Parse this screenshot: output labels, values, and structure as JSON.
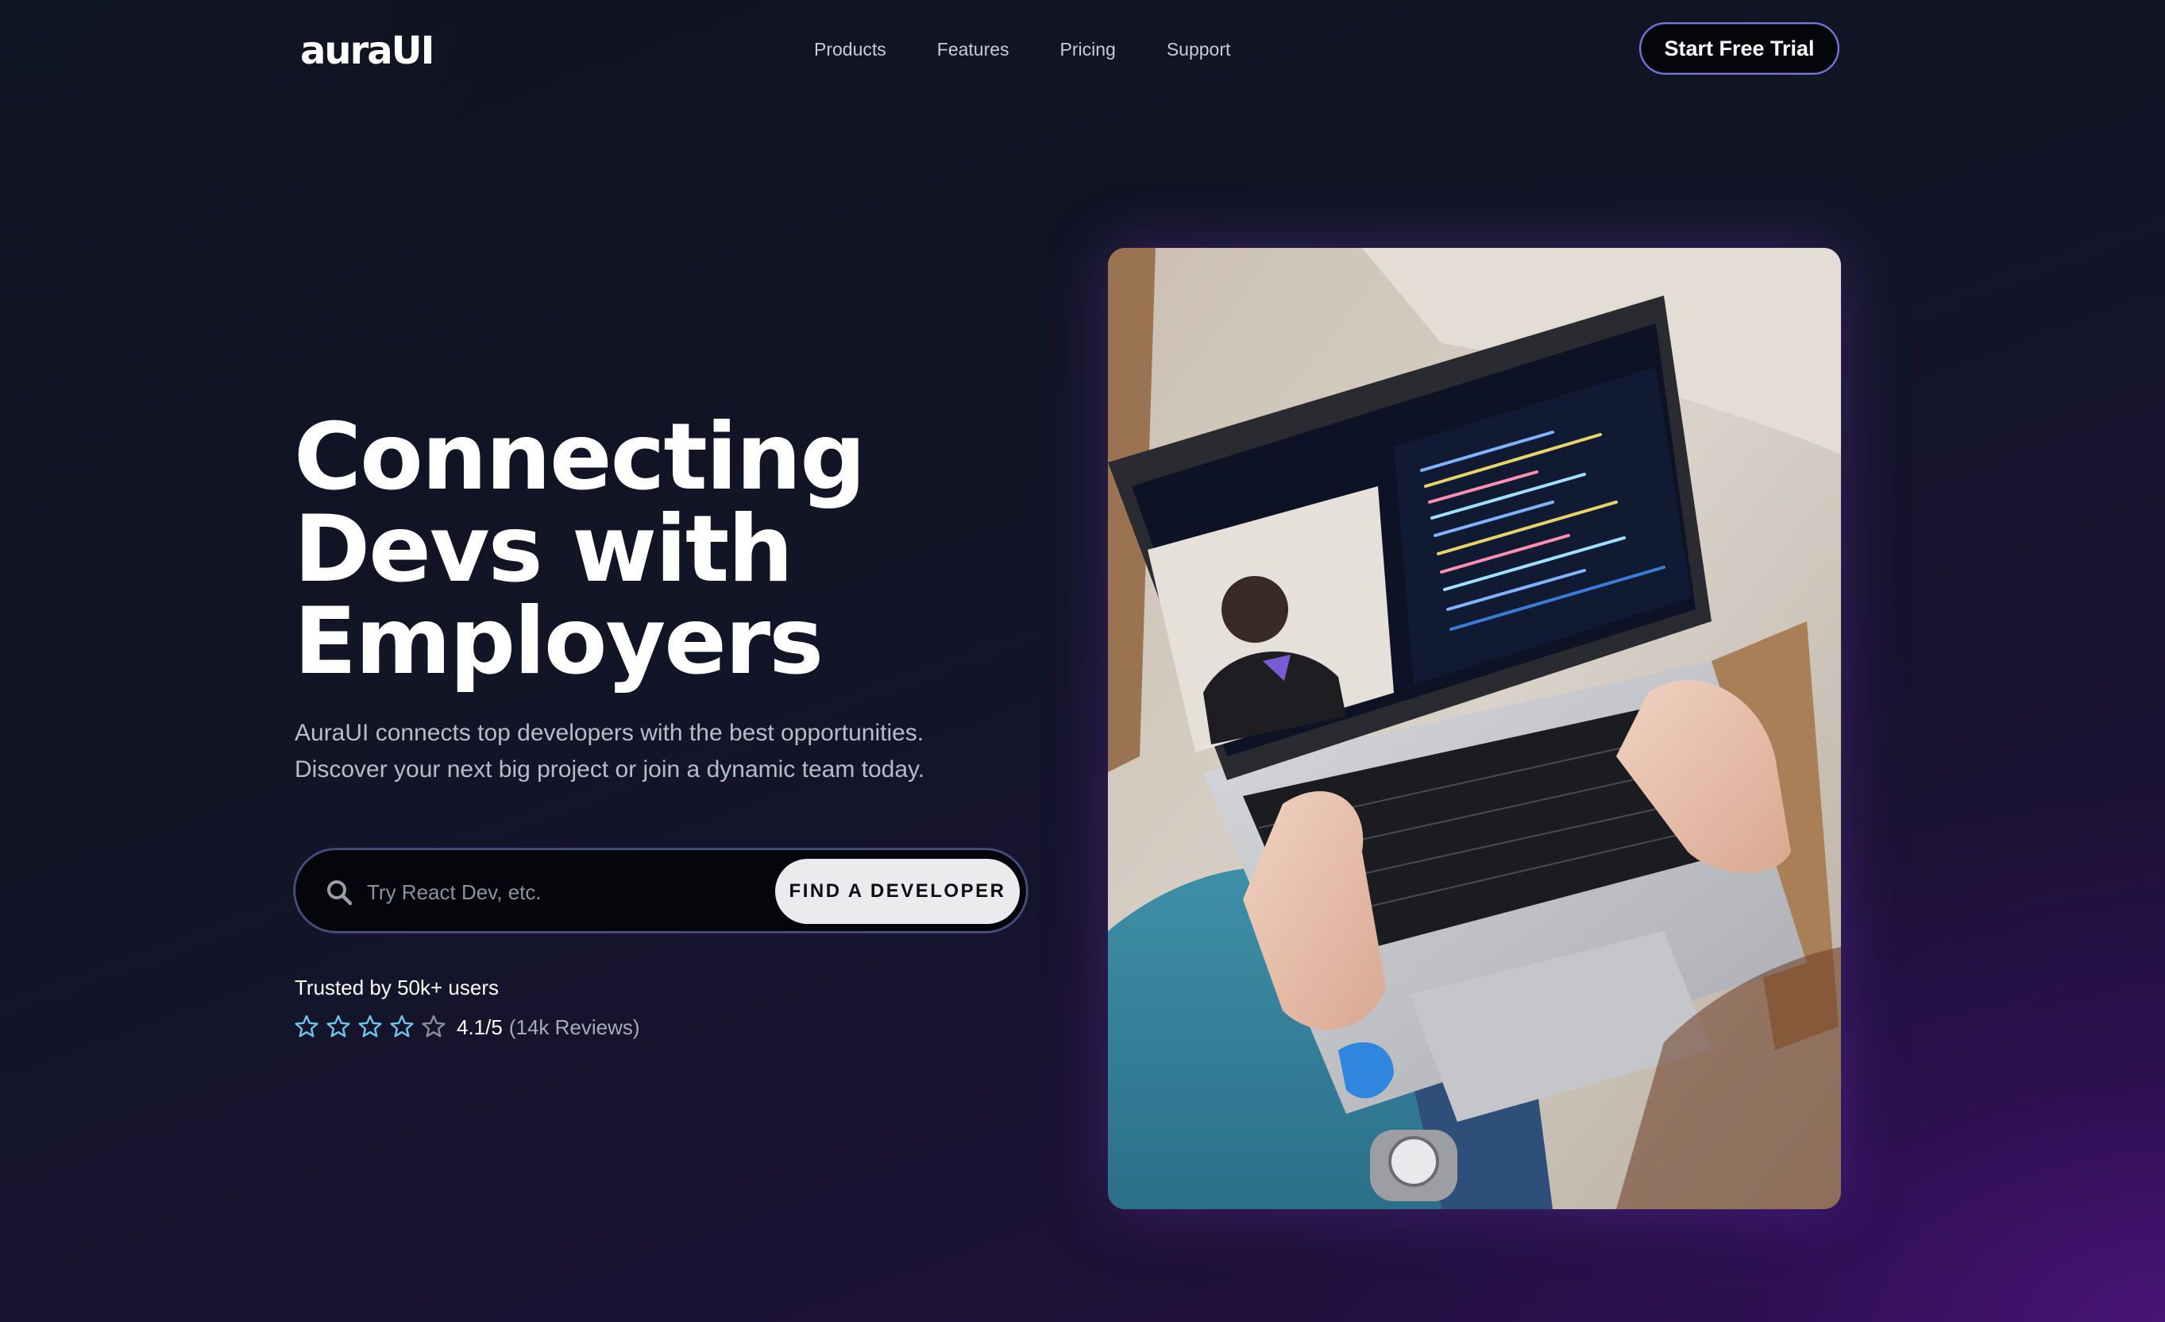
{
  "nav": {
    "logo": "auraUI",
    "links": [
      "Products",
      "Features",
      "Pricing",
      "Support"
    ],
    "cta": "Start Free Trial"
  },
  "hero": {
    "title_lines": [
      "Connecting",
      "Devs with",
      "Employers"
    ],
    "subtitle_lines": [
      "AuraUI connects top developers with the best opportunities.",
      "Discover your next big project or join a dynamic team today."
    ],
    "search": {
      "placeholder": "Try React Dev, etc.",
      "button": "FIND A DEVELOPER"
    },
    "trusted": "Trusted by 50k+ users",
    "rating": {
      "value": "4.1/5",
      "reviews": "(14k Reviews)",
      "stars_filled": 4,
      "stars_total": 5
    }
  },
  "colors": {
    "accent_star": "#6ec6f0",
    "accent_border": "#6f7fd8",
    "bg_dark": "#10131f",
    "bg_purple": "#2a0f4a"
  },
  "icons": {
    "search": "search-icon",
    "star": "star-icon"
  }
}
